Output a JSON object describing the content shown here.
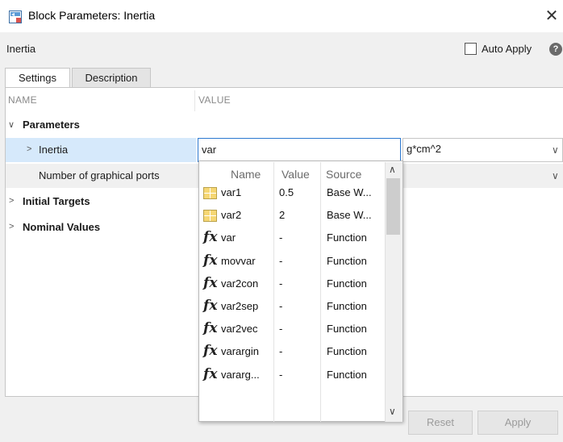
{
  "window": {
    "title": "Block Parameters: Inertia",
    "close_glyph": "✕"
  },
  "block": {
    "name": "Inertia",
    "auto_apply_label": "Auto Apply",
    "auto_apply_checked": false,
    "help_glyph": "?"
  },
  "tabs": [
    {
      "label": "Settings",
      "active": true
    },
    {
      "label": "Description",
      "active": false
    }
  ],
  "table": {
    "name_header": "NAME",
    "value_header": "VALUE"
  },
  "tree": {
    "parameters_label": "Parameters",
    "inertia_label": "Inertia",
    "inertia_value": "var",
    "inertia_unit": "g*cm^2",
    "ports_label": "Number of graphical ports",
    "initial_targets_label": "Initial Targets",
    "nominal_values_label": "Nominal Values"
  },
  "dropdown": {
    "headers": {
      "name": "Name",
      "value": "Value",
      "source": "Source"
    },
    "rows": [
      {
        "icon": "variable-icon",
        "name": "var1",
        "value": "0.5",
        "source": "Base W..."
      },
      {
        "icon": "variable-icon",
        "name": "var2",
        "value": "2",
        "source": "Base W..."
      },
      {
        "icon": "function-icon",
        "name": "var",
        "value": "-",
        "source": "Function"
      },
      {
        "icon": "function-icon",
        "name": "movvar",
        "value": "-",
        "source": "Function"
      },
      {
        "icon": "function-icon",
        "name": "var2con",
        "value": "-",
        "source": "Function"
      },
      {
        "icon": "function-icon",
        "name": "var2sep",
        "value": "-",
        "source": "Function"
      },
      {
        "icon": "function-icon",
        "name": "var2vec",
        "value": "-",
        "source": "Function"
      },
      {
        "icon": "function-icon",
        "name": "varargin",
        "value": "-",
        "source": "Function"
      },
      {
        "icon": "function-icon",
        "name": "vararg...",
        "value": "-",
        "source": "Function"
      }
    ],
    "fx_glyph": "fx"
  },
  "buttons": {
    "reset": "Reset",
    "apply": "Apply"
  },
  "colors": {
    "selection": "#d6e9fb",
    "focus_border": "#2b78d0",
    "variable_icon": "#f6d774"
  }
}
